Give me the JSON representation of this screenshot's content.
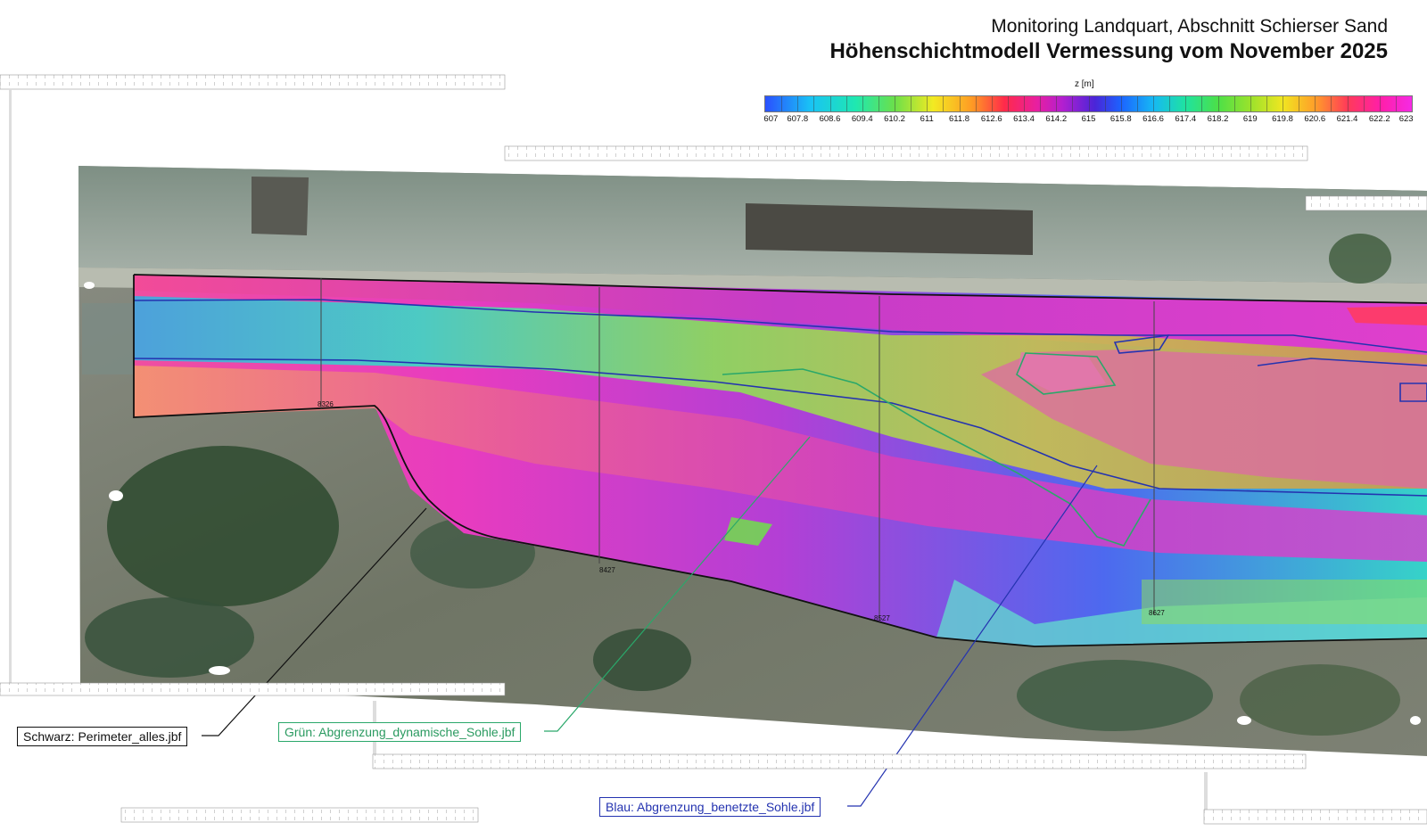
{
  "title": {
    "line1": "Monitoring Landquart, Abschnitt Schierser Sand",
    "line2": "Höhenschichtmodell Vermessung vom November 2025"
  },
  "colorbar": {
    "label": "z [m]",
    "ticks": [
      "607",
      "607.8",
      "608.6",
      "609.4",
      "610.2",
      "611",
      "611.8",
      "612.6",
      "613.4",
      "614.2",
      "615",
      "615.8",
      "616.6",
      "617.4",
      "618.2",
      "619",
      "619.8",
      "620.6",
      "621.4",
      "622.2",
      "623"
    ]
  },
  "profiles": [
    "8326",
    "8427",
    "8527",
    "8627"
  ],
  "legend": {
    "black": "Schwarz: Perimeter_alles.jbf",
    "green": "Grün: Abgrenzung_dynamische_Sohle.jbf",
    "blue": "Blau: Abgrenzung_benetzte_Sohle.jbf"
  },
  "colors": {
    "perimeter": "#111111",
    "dynamic_bed": "#2aa86a",
    "wetted_bed": "#2433b0"
  }
}
